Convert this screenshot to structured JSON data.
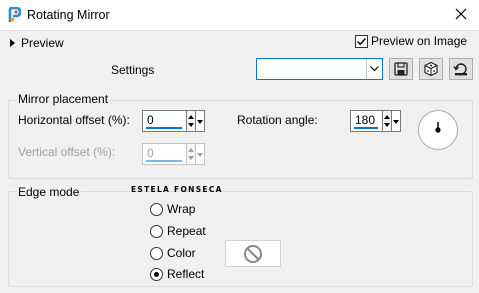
{
  "window": {
    "title": "Rotating Mirror"
  },
  "preview": {
    "label": "Preview",
    "preview_on_image_label": "Preview on Image",
    "preview_on_image_checked": true
  },
  "settings": {
    "label": "Settings",
    "value": ""
  },
  "toolbar_icons": [
    "save-icon",
    "randomize-icon",
    "reset-icon"
  ],
  "mirror_placement": {
    "title": "Mirror placement",
    "horizontal_offset": {
      "label": "Horizontal offset (%):",
      "value": "0"
    },
    "vertical_offset": {
      "label": "Vertical offset (%):",
      "value": "0",
      "disabled": true
    },
    "rotation_angle": {
      "label": "Rotation angle:",
      "value": "180"
    }
  },
  "watermark": "ESTELA FONSECA",
  "edge_mode": {
    "title": "Edge mode",
    "options": [
      "Wrap",
      "Repeat",
      "Color",
      "Reflect"
    ],
    "selected": "Reflect"
  },
  "colors": {
    "accent": "#0078d7",
    "window_bg": "#f0f0f0",
    "disabled_text": "#a0a0a0"
  }
}
